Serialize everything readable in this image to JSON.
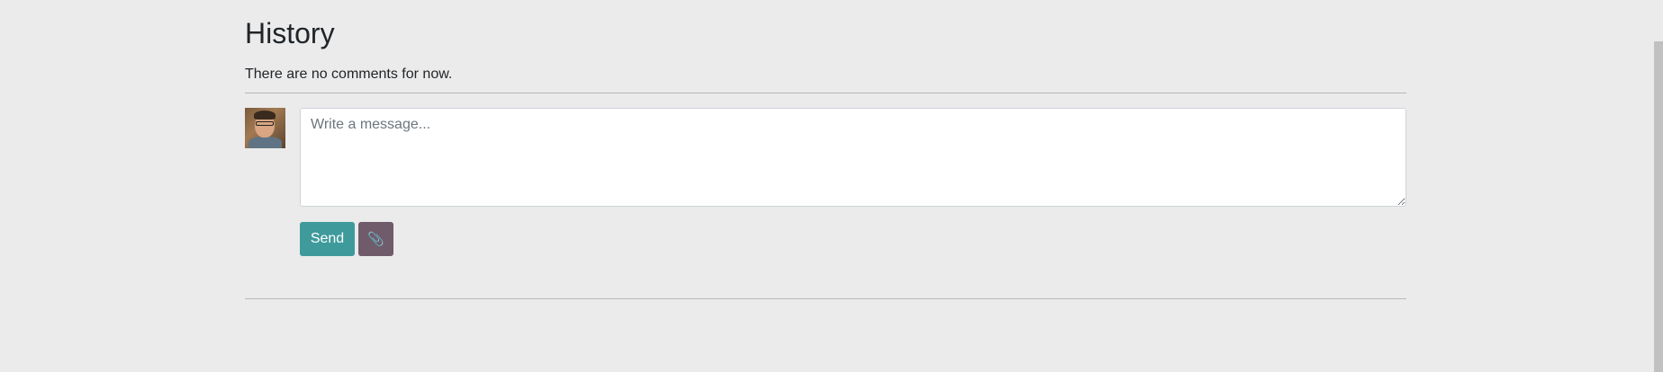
{
  "history": {
    "title": "History",
    "empty_text": "There are no comments for now."
  },
  "composer": {
    "placeholder": "Write a message...",
    "value": "",
    "send_label": "Send",
    "attach_icon": "paperclip-icon",
    "attach_glyph": "📎"
  },
  "colors": {
    "background": "#ebebeb",
    "send_button": "#3f9a9c",
    "attach_button": "#6f5b6a",
    "divider": "#b8b8b8"
  }
}
